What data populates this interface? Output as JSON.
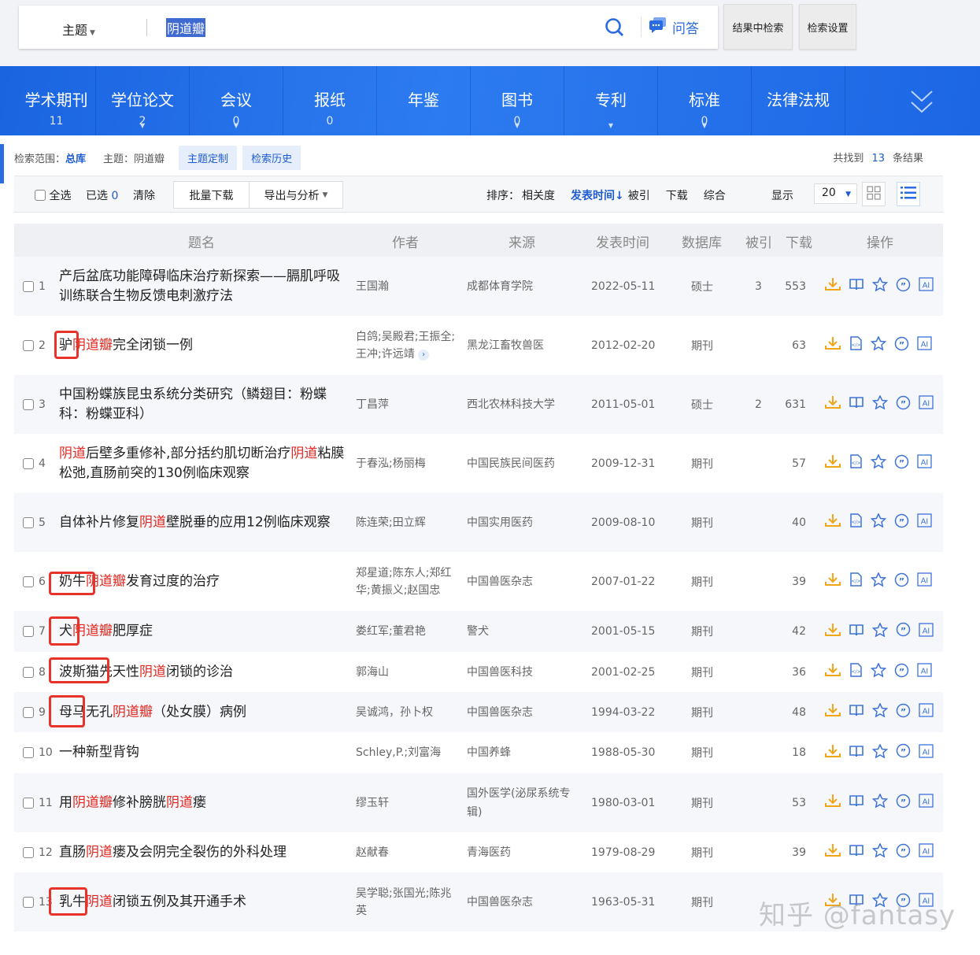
{
  "search": {
    "field_type": "主题",
    "query": "阴道瓣",
    "qa_label": "问答",
    "search_in_results": "结果中检索",
    "search_settings": "检索设置"
  },
  "nav_tabs": [
    {
      "label": "学术期刊",
      "count": "11",
      "arrow": false
    },
    {
      "label": "学位论文",
      "count": "2",
      "arrow": true
    },
    {
      "label": "会议",
      "count": "0",
      "arrow": true
    },
    {
      "label": "报纸",
      "count": "0",
      "arrow": false
    },
    {
      "label": "年鉴",
      "count": "",
      "arrow": false
    },
    {
      "label": "图书",
      "count": "0",
      "arrow": true
    },
    {
      "label": "专利",
      "count": "",
      "arrow": true
    },
    {
      "label": "标准",
      "count": "0",
      "arrow": true
    },
    {
      "label": "法律法规",
      "count": "",
      "arrow": false
    }
  ],
  "info": {
    "scope_label": "检索范围：",
    "scope_value": "总库",
    "topic": "主题：阴道瓣",
    "custom_topic": "主题定制",
    "history": "检索历史",
    "found_prefix": "共找到",
    "found_count": "13",
    "found_suffix": "条结果"
  },
  "toolbar": {
    "select_all": "全选",
    "selected_label": "已选",
    "selected_count": "0",
    "clear": "清除",
    "batch_download": "批量下载",
    "export": "导出与分析",
    "sort_label": "排序：",
    "sort_options": [
      "相关度",
      "发表时间",
      "被引",
      "下载",
      "综合"
    ],
    "active_sort": "发表时间",
    "display_label": "显示",
    "page_size": "20"
  },
  "columns": [
    "题名",
    "作者",
    "来源",
    "发表时间",
    "数据库",
    "被引",
    "下载",
    "操作"
  ],
  "rows": [
    {
      "n": "1",
      "title": [
        [
          "产后盆底功能障碍临床治疗新探索——膈肌呼吸训练联合生物反馈电刺激疗法",
          0
        ]
      ],
      "author": "王国瀚",
      "source": "成都体育学院",
      "date": "2022-05-11",
      "db": "硕士",
      "cite": "3",
      "dl": "553",
      "read": "book"
    },
    {
      "n": "2",
      "title": [
        [
          "驴",
          0
        ],
        [
          "阴道瓣",
          1
        ],
        [
          "完全闭锁一例",
          0
        ]
      ],
      "author": "白鸽;吴殿君;王振全;王冲;许远靖",
      "more": true,
      "source": "黑龙江畜牧兽医",
      "date": "2012-02-20",
      "db": "期刊",
      "cite": "",
      "dl": "63",
      "read": "html"
    },
    {
      "n": "3",
      "title": [
        [
          "中国粉蝶族昆虫系统分类研究（鳞翅目：粉蝶科：粉蝶亚科）",
          0
        ]
      ],
      "author": "丁昌萍",
      "source": "西北农林科技大学",
      "date": "2011-05-01",
      "db": "硕士",
      "cite": "2",
      "dl": "631",
      "read": "book"
    },
    {
      "n": "4",
      "title": [
        [
          "阴道",
          1
        ],
        [
          "后壁多重修补,部分括约肌切断治疗",
          0
        ],
        [
          "阴道",
          1
        ],
        [
          "粘膜松弛,直肠前突的130例临床观察",
          0
        ]
      ],
      "author": "于春泓;杨丽梅",
      "source": "中国民族民间医药",
      "date": "2009-12-31",
      "db": "期刊",
      "cite": "",
      "dl": "57",
      "read": "html"
    },
    {
      "n": "5",
      "title": [
        [
          "自体补片修复",
          0
        ],
        [
          "阴道",
          1
        ],
        [
          "壁脱垂的应用12例临床观察",
          0
        ]
      ],
      "author": "陈连荣;田立辉",
      "source": "中国实用医药",
      "date": "2009-08-10",
      "db": "期刊",
      "cite": "",
      "dl": "40",
      "read": "html"
    },
    {
      "n": "6",
      "title": [
        [
          "奶牛",
          0
        ],
        [
          "阴道瓣",
          1
        ],
        [
          "发育过度的治疗",
          0
        ]
      ],
      "author": "郑星道;陈东人;郑红华;黄振义;赵国忠",
      "source": "中国兽医杂志",
      "date": "2007-01-22",
      "db": "期刊",
      "cite": "",
      "dl": "39",
      "read": "html"
    },
    {
      "n": "7",
      "title": [
        [
          "犬",
          0
        ],
        [
          "阴道瓣",
          1
        ],
        [
          "肥厚症",
          0
        ]
      ],
      "author": "娄红军;董君艳",
      "source": "警犬",
      "date": "2001-05-15",
      "db": "期刊",
      "cite": "",
      "dl": "42",
      "read": "book"
    },
    {
      "n": "8",
      "title": [
        [
          "波斯猫先天性",
          0
        ],
        [
          "阴道",
          1
        ],
        [
          "闭锁的诊治",
          0
        ]
      ],
      "author": "郭海山",
      "source": "中国兽医科技",
      "date": "2001-02-25",
      "db": "期刊",
      "cite": "",
      "dl": "36",
      "read": "html"
    },
    {
      "n": "9",
      "title": [
        [
          "母马无孔",
          0
        ],
        [
          "阴道瓣",
          1
        ],
        [
          "（处女膜）病例",
          0
        ]
      ],
      "author": "吴诚鸿，孙卜权",
      "source": "中国兽医杂志",
      "date": "1994-03-22",
      "db": "期刊",
      "cite": "",
      "dl": "48",
      "read": "book"
    },
    {
      "n": "10",
      "title": [
        [
          "一种新型背钩",
          0
        ]
      ],
      "author": "Schley,P.;刘富海",
      "source": "中国养蜂",
      "date": "1988-05-30",
      "db": "期刊",
      "cite": "",
      "dl": "18",
      "read": "book"
    },
    {
      "n": "11",
      "title": [
        [
          "用",
          0
        ],
        [
          "阴道瓣",
          1
        ],
        [
          "修补膀胱",
          0
        ],
        [
          "阴道",
          1
        ],
        [
          "瘘",
          0
        ]
      ],
      "author": "缪玉轩",
      "source": "国外医学(泌尿系统专辑)",
      "date": "1980-03-01",
      "db": "期刊",
      "cite": "",
      "dl": "53",
      "read": "book"
    },
    {
      "n": "12",
      "title": [
        [
          "直肠",
          0
        ],
        [
          "阴道",
          1
        ],
        [
          "瘘及会阴完全裂伤的外科处理",
          0
        ]
      ],
      "author": "赵献春",
      "source": "青海医药",
      "date": "1979-08-29",
      "db": "期刊",
      "cite": "",
      "dl": "39",
      "read": "book"
    },
    {
      "n": "13",
      "title": [
        [
          "乳牛",
          0
        ],
        [
          "阴道",
          1
        ],
        [
          "闭锁五例及其开通手术",
          0
        ]
      ],
      "author": "吴学聪;张国光;陈兆英",
      "source": "中国兽医杂志",
      "date": "1963-05-31",
      "db": "期刊",
      "cite": "",
      "dl": "",
      "read": "book"
    }
  ],
  "watermark": "知乎 @fantasy",
  "colors": {
    "brand": "#1e5bd1",
    "highlight": "#e3261f",
    "download": "#f2a516",
    "annotation": "#e8332b"
  }
}
